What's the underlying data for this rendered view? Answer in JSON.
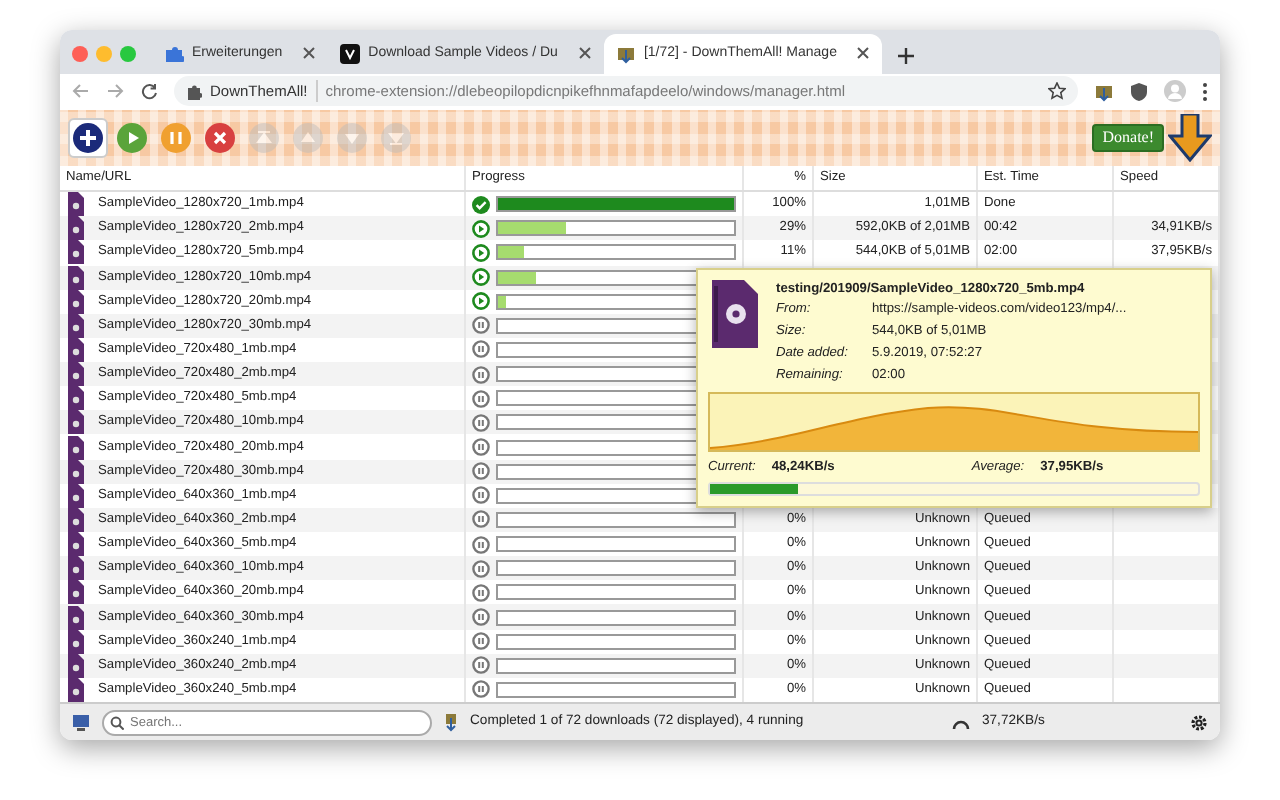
{
  "tabs": [
    {
      "title": "Erweiterungen",
      "kind": "puzzle",
      "selected": false
    },
    {
      "title": "Download Sample Videos / Du",
      "kind": "logo",
      "selected": false
    },
    {
      "title": "[1/72] - DownThemAll! Manage",
      "kind": "dta",
      "selected": true
    }
  ],
  "address": {
    "site": "DownThemAll!",
    "url": "chrome-extension://dlebeopilopdicnpikefhnmafapdeelo/windows/manager.html"
  },
  "toolbar": [
    {
      "kind": "add",
      "disabled": false
    },
    {
      "kind": "resume",
      "disabled": false
    },
    {
      "kind": "pause",
      "disabled": false
    },
    {
      "kind": "cancel",
      "disabled": false
    },
    {
      "kind": "top",
      "disabled": true
    },
    {
      "kind": "up",
      "disabled": true
    },
    {
      "kind": "down",
      "disabled": true
    },
    {
      "kind": "bottom",
      "disabled": true
    }
  ],
  "donate": "Donate!",
  "table": {
    "columns": [
      "Name/URL",
      "Progress",
      "%",
      "Size",
      "Est. Time",
      "Speed"
    ],
    "rows": [
      {
        "name": "SampleVideo_1280x720_1mb.mp4",
        "kind": "done",
        "level": 1,
        "percent": "100%",
        "size": "1,01MB",
        "time": "Done"
      },
      {
        "name": "SampleVideo_1280x720_2mb.mp4",
        "kind": "running",
        "level": 0.29,
        "percent": "29%",
        "size": "592,0KB of 2,01MB",
        "time": "00:42",
        "speed": "34,91KB/s"
      },
      {
        "name": "SampleVideo_1280x720_5mb.mp4",
        "kind": "running",
        "level": 0.11,
        "percent": "11%",
        "size": "544,0KB of 5,01MB",
        "time": "02:00",
        "speed": "37,95KB/s"
      },
      {
        "name": "SampleVideo_1280x720_10mb.mp4",
        "kind": "running",
        "level": 0.16
      },
      {
        "name": "SampleVideo_1280x720_20mb.mp4",
        "kind": "running",
        "level": 0.03
      },
      {
        "name": "SampleVideo_1280x720_30mb.mp4",
        "kind": "queued",
        "level": 0
      },
      {
        "name": "SampleVideo_720x480_1mb.mp4",
        "kind": "queued",
        "level": 0
      },
      {
        "name": "SampleVideo_720x480_2mb.mp4",
        "kind": "queued",
        "level": 0
      },
      {
        "name": "SampleVideo_720x480_5mb.mp4",
        "kind": "queued",
        "level": 0
      },
      {
        "name": "SampleVideo_720x480_10mb.mp4",
        "kind": "queued",
        "level": 0
      },
      {
        "name": "SampleVideo_720x480_20mb.mp4",
        "kind": "queued",
        "level": 0
      },
      {
        "name": "SampleVideo_720x480_30mb.mp4",
        "kind": "queued",
        "level": 0
      },
      {
        "name": "SampleVideo_640x360_1mb.mp4",
        "kind": "queued",
        "level": 0
      },
      {
        "name": "SampleVideo_640x360_2mb.mp4",
        "kind": "queued",
        "level": 0,
        "percent": "0%",
        "size": "Unknown",
        "time": "Queued"
      },
      {
        "name": "SampleVideo_640x360_5mb.mp4",
        "kind": "queued",
        "level": 0,
        "percent": "0%",
        "size": "Unknown",
        "time": "Queued"
      },
      {
        "name": "SampleVideo_640x360_10mb.mp4",
        "kind": "queued",
        "level": 0,
        "percent": "0%",
        "size": "Unknown",
        "time": "Queued"
      },
      {
        "name": "SampleVideo_640x360_20mb.mp4",
        "kind": "queued",
        "level": 0,
        "percent": "0%",
        "size": "Unknown",
        "time": "Queued"
      },
      {
        "name": "SampleVideo_640x360_30mb.mp4",
        "kind": "queued",
        "level": 0,
        "percent": "0%",
        "size": "Unknown",
        "time": "Queued"
      },
      {
        "name": "SampleVideo_360x240_1mb.mp4",
        "kind": "queued",
        "level": 0,
        "percent": "0%",
        "size": "Unknown",
        "time": "Queued"
      },
      {
        "name": "SampleVideo_360x240_2mb.mp4",
        "kind": "queued",
        "level": 0,
        "percent": "0%",
        "size": "Unknown",
        "time": "Queued"
      },
      {
        "name": "SampleVideo_360x240_5mb.mp4",
        "kind": "queued",
        "level": 0,
        "percent": "0%",
        "size": "Unknown",
        "time": "Queued"
      }
    ]
  },
  "tooltip": {
    "title": "testing/201909/SampleVideo_1280x720_5mb.mp4",
    "fields": [
      {
        "label": "From:",
        "value": "https://sample-videos.com/video123/mp4/..."
      },
      {
        "label": "Size:",
        "value": "544,0KB of 5,01MB"
      },
      {
        "label": "Date added:",
        "value": "5.9.2019, 07:52:27"
      },
      {
        "label": "Remaining:",
        "value": "02:00"
      }
    ],
    "current_label": "Current:",
    "current": "48,24KB/s",
    "average_label": "Average:",
    "average": "37,95KB/s",
    "level": 0.18
  },
  "status_bar": {
    "search_placeholder": "Search...",
    "summary": "Completed 1 of 72 downloads (72 displayed), 4 running",
    "speed": "37,72KB/s"
  }
}
